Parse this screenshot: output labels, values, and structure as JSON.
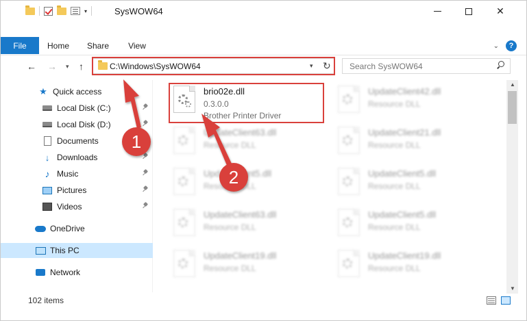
{
  "window": {
    "title": "SysWOW64",
    "minimize_glyph": "",
    "close_glyph": "✕"
  },
  "ribbon": {
    "tabs": [
      "File",
      "Home",
      "Share",
      "View"
    ],
    "help_glyph": "?"
  },
  "navigation": {
    "back_glyph": "←",
    "forward_glyph": "→",
    "recent_glyph": "▾",
    "up_glyph": "↑",
    "address": "C:\\Windows\\SysWOW64",
    "refresh_glyph": "↻",
    "search_placeholder": "Search SysWOW64"
  },
  "sidebar": {
    "items": [
      {
        "label": "Quick access"
      },
      {
        "label": "Local Disk (C:)"
      },
      {
        "label": "Local Disk (D:)"
      },
      {
        "label": "Documents"
      },
      {
        "label": "Downloads"
      },
      {
        "label": "Music"
      },
      {
        "label": "Pictures"
      },
      {
        "label": "Videos"
      },
      {
        "label": "OneDrive"
      },
      {
        "label": "This PC"
      },
      {
        "label": "Network"
      }
    ]
  },
  "files": {
    "highlighted": {
      "name": "brio02e.dll",
      "version": "0.3.0.0",
      "description": "Brother Printer Driver"
    },
    "left_column": [
      {
        "name": "UpdateClient63.dll",
        "type": "Resource DLL"
      },
      {
        "name": "UpdateClient5.dll",
        "type": "Resource DLL"
      },
      {
        "name": "UpdateClient63.dll",
        "type": "Resource DLL"
      },
      {
        "name": "UpdateClient19.dll",
        "type": "Resource DLL"
      }
    ],
    "right_column": [
      {
        "name": "UpdateClient42.dll",
        "type": "Resource DLL"
      },
      {
        "name": "UpdateClient21.dll",
        "type": "Resource DLL"
      },
      {
        "name": "UpdateClient5.dll",
        "type": "Resource DLL"
      },
      {
        "name": "UpdateClient5.dll",
        "type": "Resource DLL"
      },
      {
        "name": "UpdateClient19.dll",
        "type": "Resource DLL"
      }
    ]
  },
  "status": {
    "item_count": "102 items"
  },
  "annotations": {
    "step1": "1",
    "step2": "2"
  },
  "colors": {
    "accent": "#1979ca",
    "highlight_red": "#d9403b",
    "selection": "#cce8ff"
  }
}
